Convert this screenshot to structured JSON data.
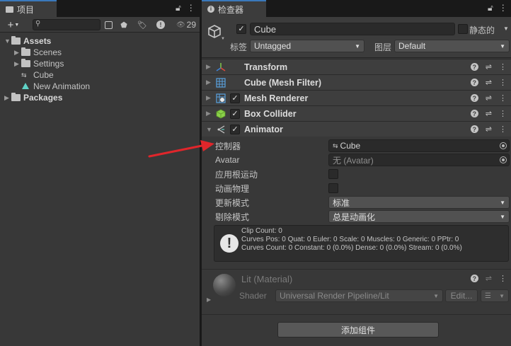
{
  "project": {
    "tab_title": "项目",
    "hidden_count": "29",
    "search_placeholder": "",
    "tree": [
      {
        "label": "Assets",
        "level": 0,
        "type": "folder",
        "expanded": true
      },
      {
        "label": "Scenes",
        "level": 1,
        "type": "folder"
      },
      {
        "label": "Settings",
        "level": 1,
        "type": "folder"
      },
      {
        "label": "Cube",
        "level": 1,
        "type": "animator-controller"
      },
      {
        "label": "New Animation",
        "level": 1,
        "type": "animation-clip"
      },
      {
        "label": "Packages",
        "level": 0,
        "type": "folder"
      }
    ]
  },
  "inspector": {
    "tab_title": "检查器",
    "object_name": "Cube",
    "static_label": "静态的",
    "tag_label": "标签",
    "tag_value": "Untagged",
    "layer_label": "图层",
    "layer_value": "Default",
    "components": [
      {
        "name": "Transform",
        "has_check": false
      },
      {
        "name": "Cube (Mesh Filter)",
        "has_check": false
      },
      {
        "name": "Mesh Renderer",
        "has_check": true
      },
      {
        "name": "Box Collider",
        "has_check": true
      },
      {
        "name": "Animator",
        "has_check": true
      }
    ],
    "animator": {
      "controller_label": "控制器",
      "controller_value": "Cube",
      "avatar_label": "Avatar",
      "avatar_value": "无 (Avatar)",
      "root_motion_label": "应用根运动",
      "animate_physics_label": "动画物理",
      "update_mode_label": "更新模式",
      "update_mode_value": "标准",
      "culling_mode_label": "剔除模式",
      "culling_mode_value": "总是动画化",
      "info_line1": "Clip Count: 0",
      "info_line2": "Curves Pos: 0 Quat: 0 Euler: 0 Scale: 0 Muscles: 0 Generic: 0 PPtr: 0",
      "info_line3": "Curves Count: 0 Constant: 0 (0.0%) Dense: 0 (0.0%) Stream: 0 (0.0%)"
    },
    "material": {
      "name": "Lit (Material)",
      "shader_label": "Shader",
      "shader_value": "Universal Render Pipeline/Lit",
      "edit_label": "Edit..."
    },
    "add_component_label": "添加组件"
  },
  "colors": {
    "accent_blue": "#3a79bb",
    "annotation_arrow": "#e0262b",
    "panel_bg": "#383838",
    "header_bg": "#3c3c3c"
  }
}
